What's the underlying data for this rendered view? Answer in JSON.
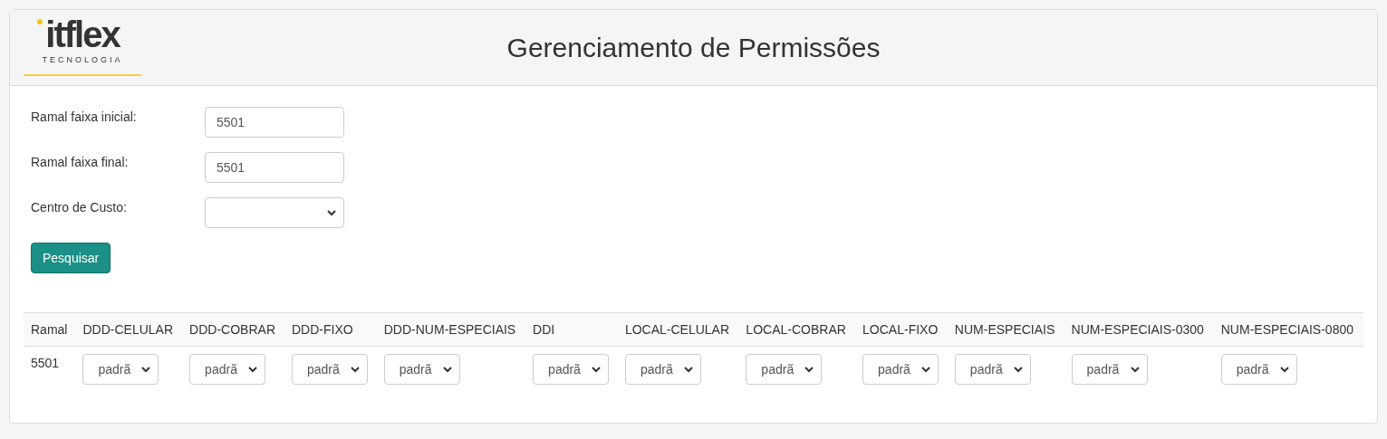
{
  "header": {
    "logo": {
      "name": "itflex",
      "tagline": "TECNOLOGIA"
    },
    "title": "Gerenciamento de Permissões"
  },
  "form": {
    "fields": [
      {
        "label": "Ramal faixa inicial:",
        "kind": "text",
        "value": "5501"
      },
      {
        "label": "Ramal faixa final:",
        "kind": "text",
        "value": "5501"
      },
      {
        "label": "Centro de Custo:",
        "kind": "select"
      }
    ],
    "button": "Pesquisar"
  },
  "table": {
    "columns": [
      "Ramal",
      "DDD-CELULAR",
      "DDD-COBRAR",
      "DDD-FIXO",
      "DDD-NUM-ESPECIAIS",
      "DDI",
      "LOCAL-CELULAR",
      "LOCAL-COBRAR",
      "LOCAL-FIXO",
      "NUM-ESPECIAIS",
      "NUM-ESPECIAIS-0300",
      "NUM-ESPECIAIS-0800"
    ],
    "rows": [
      {
        "ramal": "5501",
        "selects": [
          "padrã",
          "padrã",
          "padrã",
          "padrã",
          "padrã",
          "padrã",
          "padrã",
          "padrã",
          "padrã",
          "padrã",
          "padrã"
        ]
      }
    ]
  }
}
